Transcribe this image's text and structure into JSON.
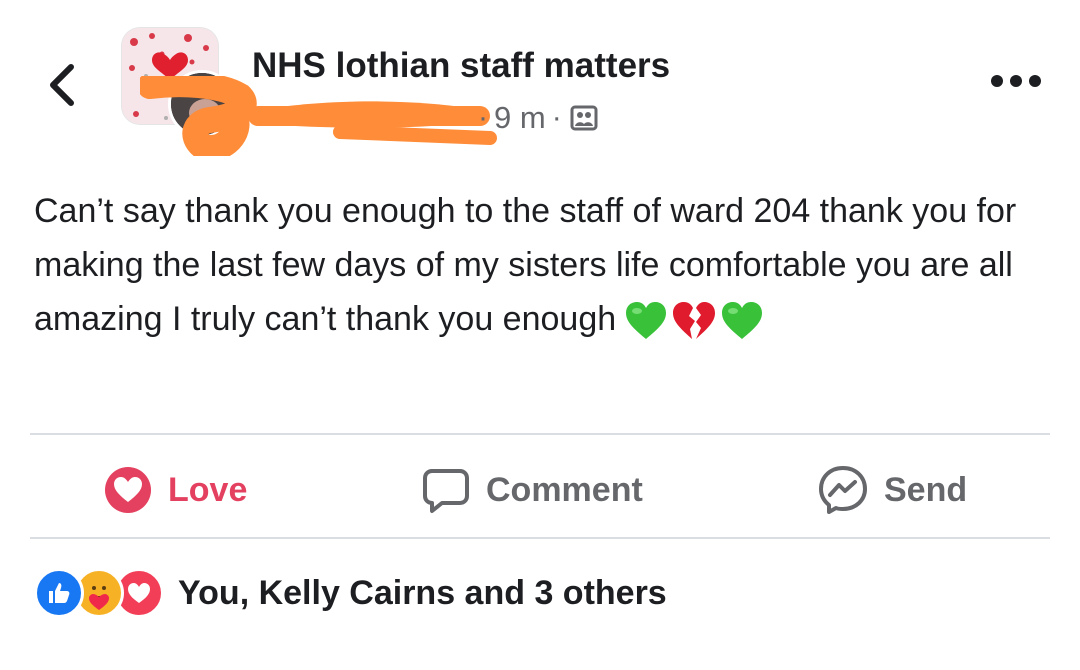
{
  "header": {
    "back_icon": "chevron-left-icon",
    "group_name": "NHS lothian staff matters",
    "time_ago": "9 m",
    "separator": "·",
    "audience_icon": "members-icon",
    "more_icon": "more-horizontal-icon"
  },
  "post": {
    "text": "Can’t say thank you enough to the staff of ward 204 thank you for making the last few days of my sisters life comfortable you are all amazing I truly can’t thank you enough",
    "emojis": [
      "green-heart",
      "broken-heart",
      "green-heart"
    ]
  },
  "actions": {
    "love_label": "Love",
    "comment_label": "Comment",
    "send_label": "Send"
  },
  "reactions": {
    "summary": "You, Kelly Cairns and 3 others",
    "types": [
      "like",
      "care",
      "love"
    ]
  },
  "colors": {
    "love": "#e4405f",
    "like": "#1877f2",
    "redaction": "#ff8c38",
    "secondary_text": "#65676b",
    "green_heart": "#39c13a"
  }
}
